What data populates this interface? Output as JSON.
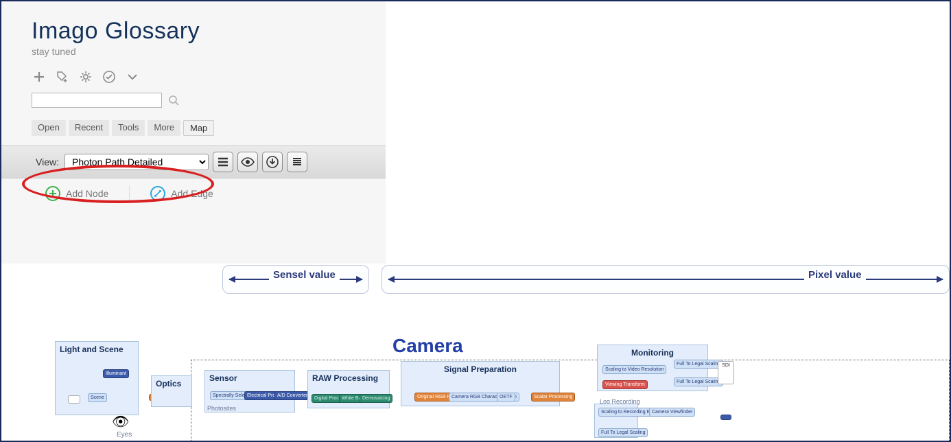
{
  "sidebar": {
    "title": "Imago Glossary",
    "subtitle": "stay tuned",
    "tabs": [
      "Open",
      "Recent",
      "Tools",
      "More",
      "Map"
    ],
    "active_tab": "Map",
    "view_label": "View:",
    "view_value": "Photon Path Detailed",
    "add_node": "Add Node",
    "add_edge": "Add Edge"
  },
  "diagram": {
    "region1_label": "Sensel value",
    "region2_label": "Pixel value",
    "big_label": "Camera",
    "groups": {
      "light_scene": "Light and Scene",
      "optics": "Optics",
      "sensor": "Sensor",
      "photosites": "Photosites",
      "raw": "RAW Processing",
      "signal_prep": "Signal Preparation",
      "monitoring": "Monitoring",
      "log_rec": "Log Recording"
    },
    "labels": {
      "eyes": "Eyes",
      "illuminant": "Illuminant",
      "scene": "Scene",
      "spectral": "Spectrally Selective Filtering",
      "electrical": "Electrical Processing",
      "adconv": "A/D Converter",
      "digital_proc": "Digital Processing",
      "wb": "White Balance",
      "demosaic": "Demosaicing",
      "orig_rgb": "Original RGB Processing",
      "cam_rgb": "Camera RGB Characterization",
      "oetf": "OETF",
      "scalar": "Scalar Processing",
      "scale_video": "Scaling to Video Resolution",
      "viewing": "Viewing Transform",
      "full_legal1": "Full To Legal Scaling",
      "full_legal2": "Full To Legal Scaling",
      "full_legal3": "Full To Legal Scaling",
      "scale_rec": "Scaling to Recording Resolution",
      "cam_viewfinder": "Camera Viewfinder",
      "sdi": "SDI"
    }
  }
}
